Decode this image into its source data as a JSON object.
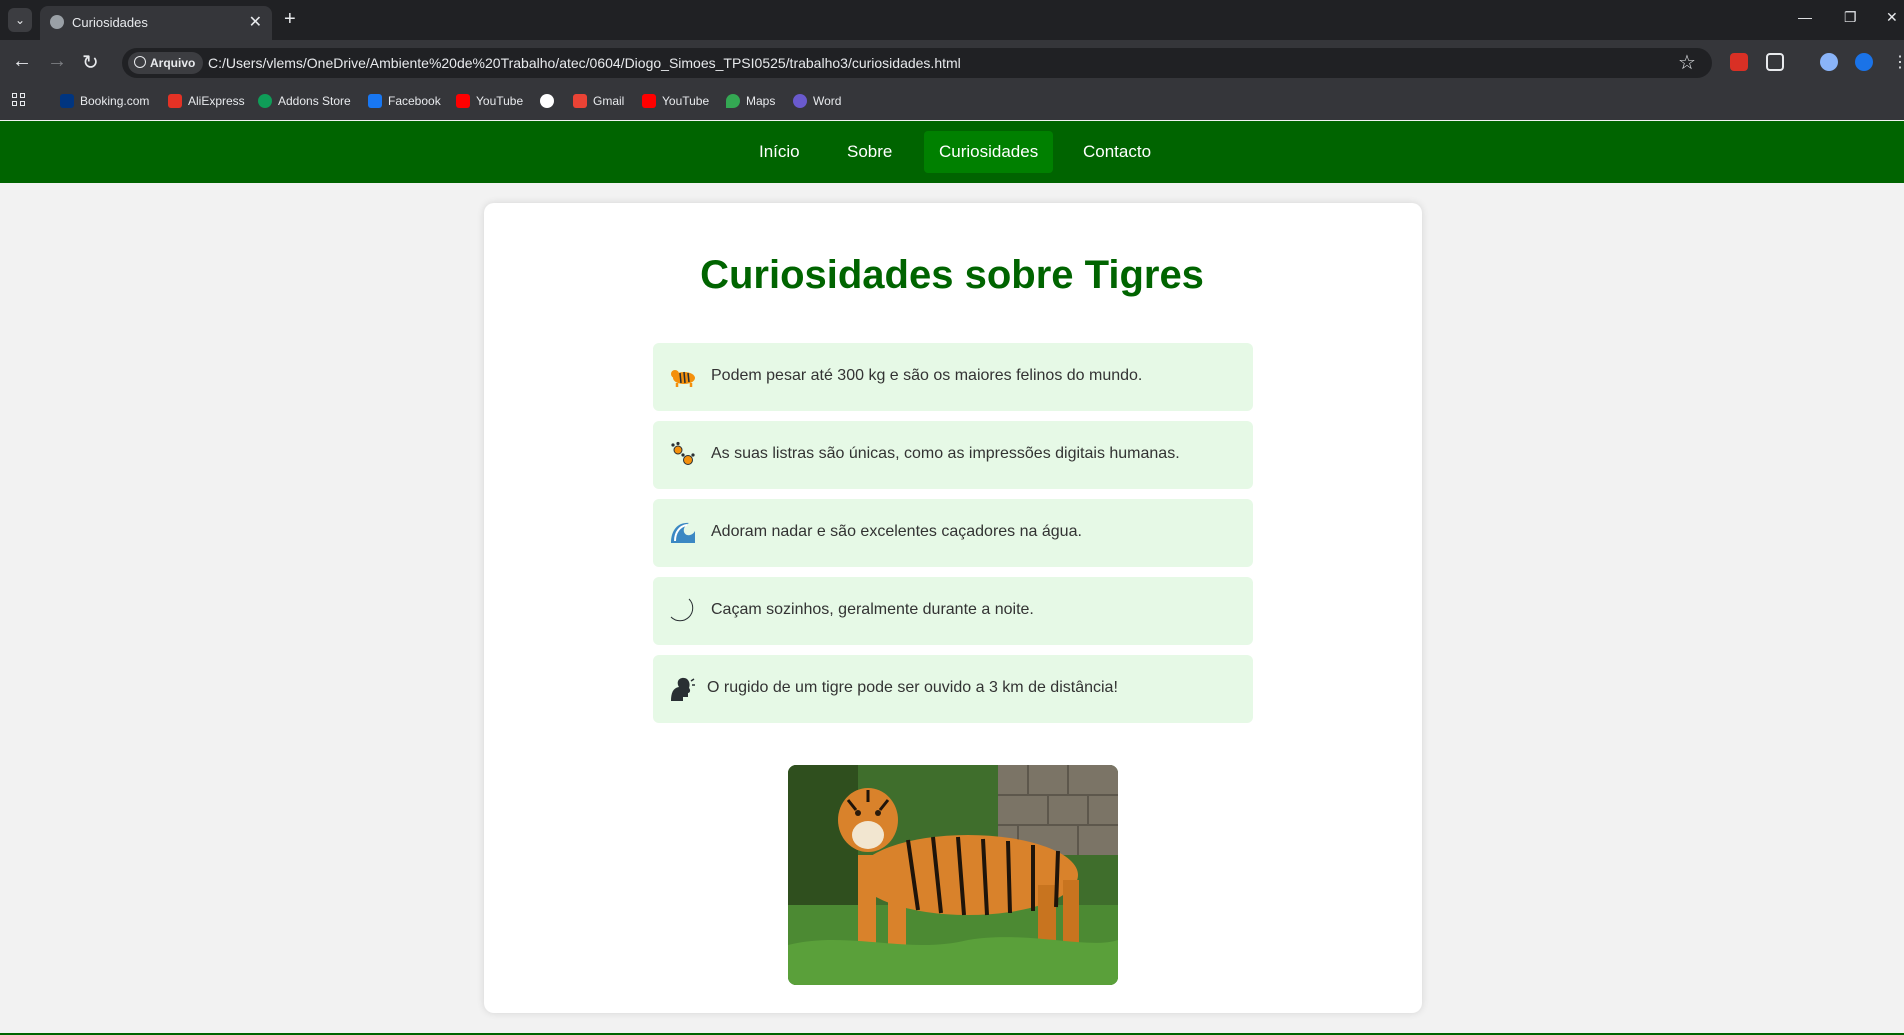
{
  "browser": {
    "tab_title": "Curiosidades",
    "new_tab_symbol": "+",
    "address_chip": "Arquivo",
    "url": "C:/Users/vlems/OneDrive/Ambiente%20de%20Trabalho/atec/0604/Diogo_Simoes_TPSI0525/trabalho3/curiosidades.html",
    "bookmarks": [
      "Booking.com",
      "AliExpress",
      "Addons Store",
      "Facebook",
      "YouTube",
      "",
      "Gmail",
      "YouTube",
      "Maps",
      "Word"
    ]
  },
  "site": {
    "nav": [
      "Início",
      "Sobre",
      "Curiosidades",
      "Contacto"
    ],
    "active_nav": "Curiosidades",
    "heading": "Curiosidades sobre Tigres",
    "facts": [
      {
        "icon": "tiger-icon",
        "text": "Podem pesar até 300 kg e são os maiores felinos do mundo."
      },
      {
        "icon": "paw-prints-icon",
        "text": "As suas listras são únicas, como as impressões digitais humanas."
      },
      {
        "icon": "water-wave-icon",
        "text": "Adoram nadar e são excelentes caçadores na água."
      },
      {
        "icon": "crescent-moon-icon",
        "text": "Caçam sozinhos, geralmente durante a noite."
      },
      {
        "icon": "speaking-head-icon",
        "text": "O rugido de um tigre pode ser ouvido a 3 km de distância!"
      }
    ],
    "image": "tiger-photo"
  },
  "colors": {
    "nav_bg": "#006400",
    "nav_active": "#008000",
    "heading": "#006400",
    "fact_bg": "#e6f9e6",
    "page_bg": "#f2f2f2"
  }
}
